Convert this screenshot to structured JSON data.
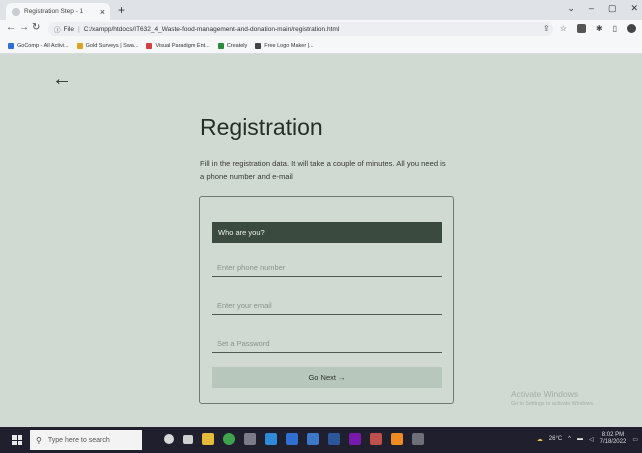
{
  "browser": {
    "tab_title": "Registration Step - 1",
    "tab_close": "×",
    "new_tab": "+",
    "url_scheme_label": "File",
    "url": "C:/xampp/htdocs/IT632_4_Waste-food-management-and-donation-main/registration.html",
    "window_controls": [
      "⌄",
      "–",
      "▢",
      "✕"
    ]
  },
  "bookmarks": [
    {
      "label": "GoComp - All Activi...",
      "color": "#2f6fd1"
    },
    {
      "label": "Gold Surveys | Swa...",
      "color": "#e0a020"
    },
    {
      "label": "Visual Paradigm Ent...",
      "color": "#d04040"
    },
    {
      "label": "Creately",
      "color": "#2c8a3c"
    },
    {
      "label": "Free Logo Maker |...",
      "color": "#444444"
    }
  ],
  "page": {
    "back_arrow": "←",
    "title": "Registration",
    "description": "Fill in the registration data. It will take a couple of minutes. All you need is a phone number and e-mail",
    "form": {
      "who_label": "Who are you?",
      "phone_placeholder": "Enter phone number",
      "email_placeholder": "Enter your email",
      "password_placeholder": "Set a Password",
      "next_button": "Go Next →"
    }
  },
  "watermark": {
    "line1": "Activate Windows",
    "line2": "Go to Settings to activate Windows."
  },
  "taskbar": {
    "search_placeholder": "Type here to search",
    "weather": "26°C",
    "time": "8:02 PM",
    "date": "7/18/2022"
  },
  "colors": {
    "page_bg": "#d0d9d2",
    "who_bar": "#3a4a3e",
    "next_button": "#b7c7bb",
    "taskbar": "#1f1f2d"
  }
}
